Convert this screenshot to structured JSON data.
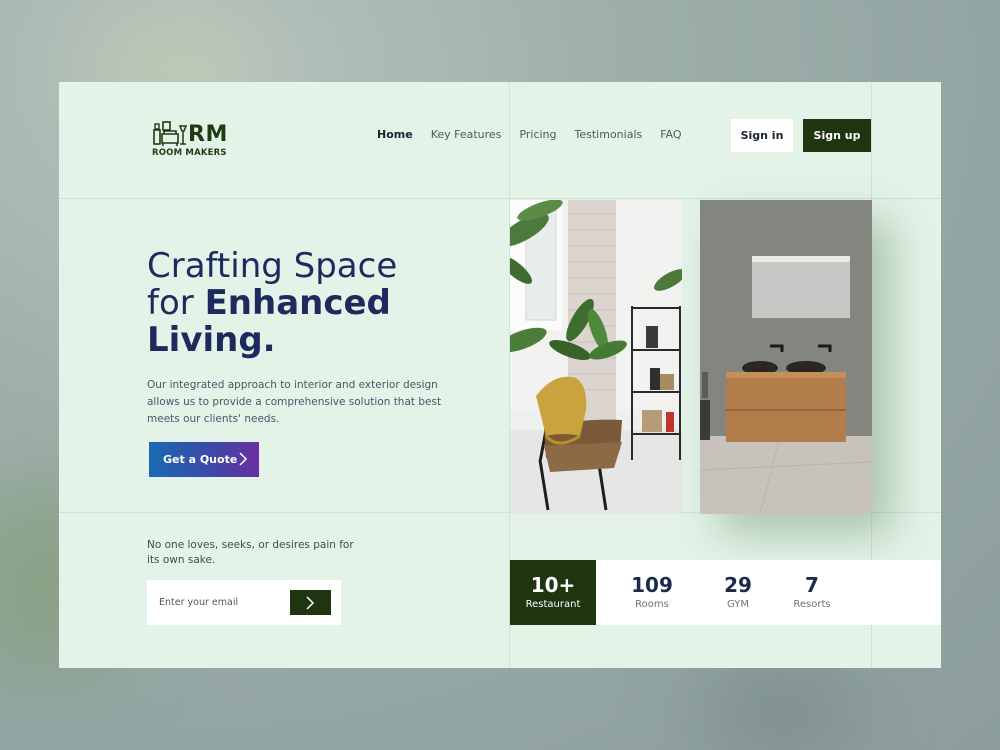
{
  "brand": {
    "logo_mark": "RM",
    "logo_name": "ROOM MAKERS",
    "logo_icon": "furniture-icon",
    "accent_dark": "#1f3510",
    "title_color": "#1d2a5e"
  },
  "nav": {
    "items": [
      {
        "label": "Home",
        "active": true
      },
      {
        "label": "Key Features",
        "active": false
      },
      {
        "label": "Pricing",
        "active": false
      },
      {
        "label": "Testimonials",
        "active": false
      },
      {
        "label": "FAQ",
        "active": false
      }
    ],
    "signin_label": "Sign in",
    "signup_label": "Sign up"
  },
  "hero": {
    "title_line1": "Crafting Space",
    "title_line2_light": "for ",
    "title_line2_bold": "Enhanced",
    "title_line3": "Living.",
    "description": "Our integrated approach to interior and exterior design allows us to provide a comprehensive solution that best meets our clients' needs.",
    "cta_label": "Get a Quote",
    "cta_icon": "chevron-right-icon"
  },
  "newsletter": {
    "tagline": "No one loves, seeks, or desires pain for its own sake.",
    "email_placeholder": "Enter your email",
    "submit_icon": "chevron-right-icon"
  },
  "stats": [
    {
      "value": "10+",
      "label": "Restaurant",
      "highlight": true
    },
    {
      "value": "109",
      "label": "Rooms",
      "highlight": false
    },
    {
      "value": "29",
      "label": "GYM",
      "highlight": false
    },
    {
      "value": "7",
      "label": "Resorts",
      "highlight": false
    }
  ],
  "images": {
    "left": "living-room-chair-photo",
    "right": "bathroom-vanity-photo"
  }
}
